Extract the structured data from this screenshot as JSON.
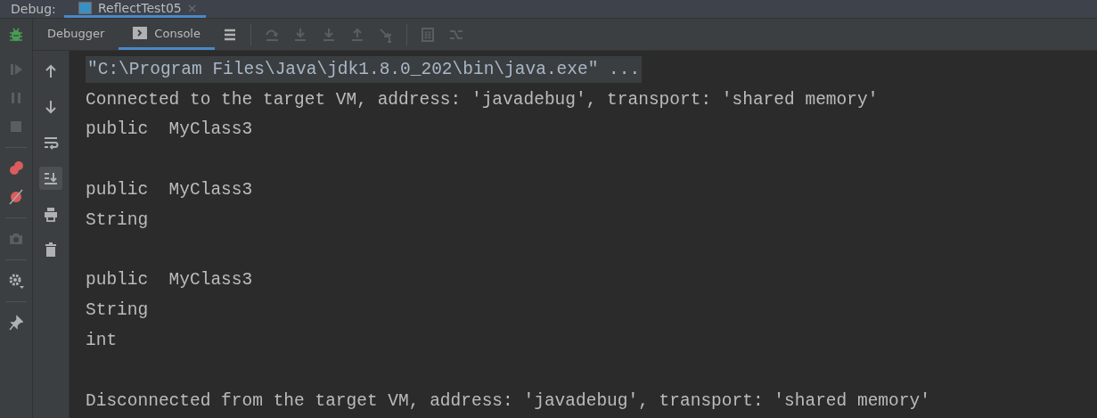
{
  "header": {
    "label": "Debug:",
    "tab": {
      "title": "ReflectTest05",
      "close": "×",
      "selected": true
    }
  },
  "tabs": [
    {
      "label": "Debugger",
      "kind": "debugger",
      "selected": false
    },
    {
      "label": "Console",
      "kind": "console",
      "selected": true
    }
  ],
  "toolbar": [
    {
      "kind": "layout",
      "disabled": false
    },
    {
      "kind": "sep"
    },
    {
      "kind": "step-over",
      "disabled": true
    },
    {
      "kind": "step-into",
      "disabled": true
    },
    {
      "kind": "force-step-into",
      "disabled": true
    },
    {
      "kind": "step-out",
      "disabled": true
    },
    {
      "kind": "run-to-cursor",
      "disabled": true
    },
    {
      "kind": "sep"
    },
    {
      "kind": "evaluate",
      "disabled": true
    },
    {
      "kind": "trace",
      "disabled": true
    }
  ],
  "left_toolbar": [
    {
      "kind": "resume",
      "disabled": true
    },
    {
      "kind": "pause",
      "disabled": true
    },
    {
      "kind": "stop",
      "disabled": true
    },
    {
      "kind": "sep"
    },
    {
      "kind": "breakpoints"
    },
    {
      "kind": "mute"
    },
    {
      "kind": "sep"
    },
    {
      "kind": "camera",
      "disabled": true
    },
    {
      "kind": "sep"
    },
    {
      "kind": "settings",
      "disabled": false
    },
    {
      "kind": "sep"
    },
    {
      "kind": "pin",
      "disabled": false
    }
  ],
  "console_toolbar": [
    {
      "kind": "up",
      "on": false
    },
    {
      "kind": "down",
      "on": false
    },
    {
      "kind": "wrap",
      "on": false
    },
    {
      "kind": "scroll-end",
      "on": true
    },
    {
      "kind": "print",
      "on": false
    },
    {
      "kind": "clear",
      "on": false
    }
  ],
  "console": [
    {
      "kind": "command",
      "text": "\"C:\\Program Files\\Java\\jdk1.8.0_202\\bin\\java.exe\" ..."
    },
    {
      "kind": "output",
      "text": "Connected to the target VM, address: 'javadebug', transport: 'shared memory'"
    },
    {
      "kind": "output",
      "text": "public  MyClass3"
    },
    {
      "kind": "blank"
    },
    {
      "kind": "output",
      "text": "public  MyClass3"
    },
    {
      "kind": "output",
      "text": "String"
    },
    {
      "kind": "blank"
    },
    {
      "kind": "output",
      "text": "public  MyClass3"
    },
    {
      "kind": "output",
      "text": "String"
    },
    {
      "kind": "output",
      "text": "int"
    },
    {
      "kind": "blank"
    },
    {
      "kind": "output",
      "text": "Disconnected from the target VM, address: 'javadebug', transport: 'shared memory'"
    }
  ]
}
